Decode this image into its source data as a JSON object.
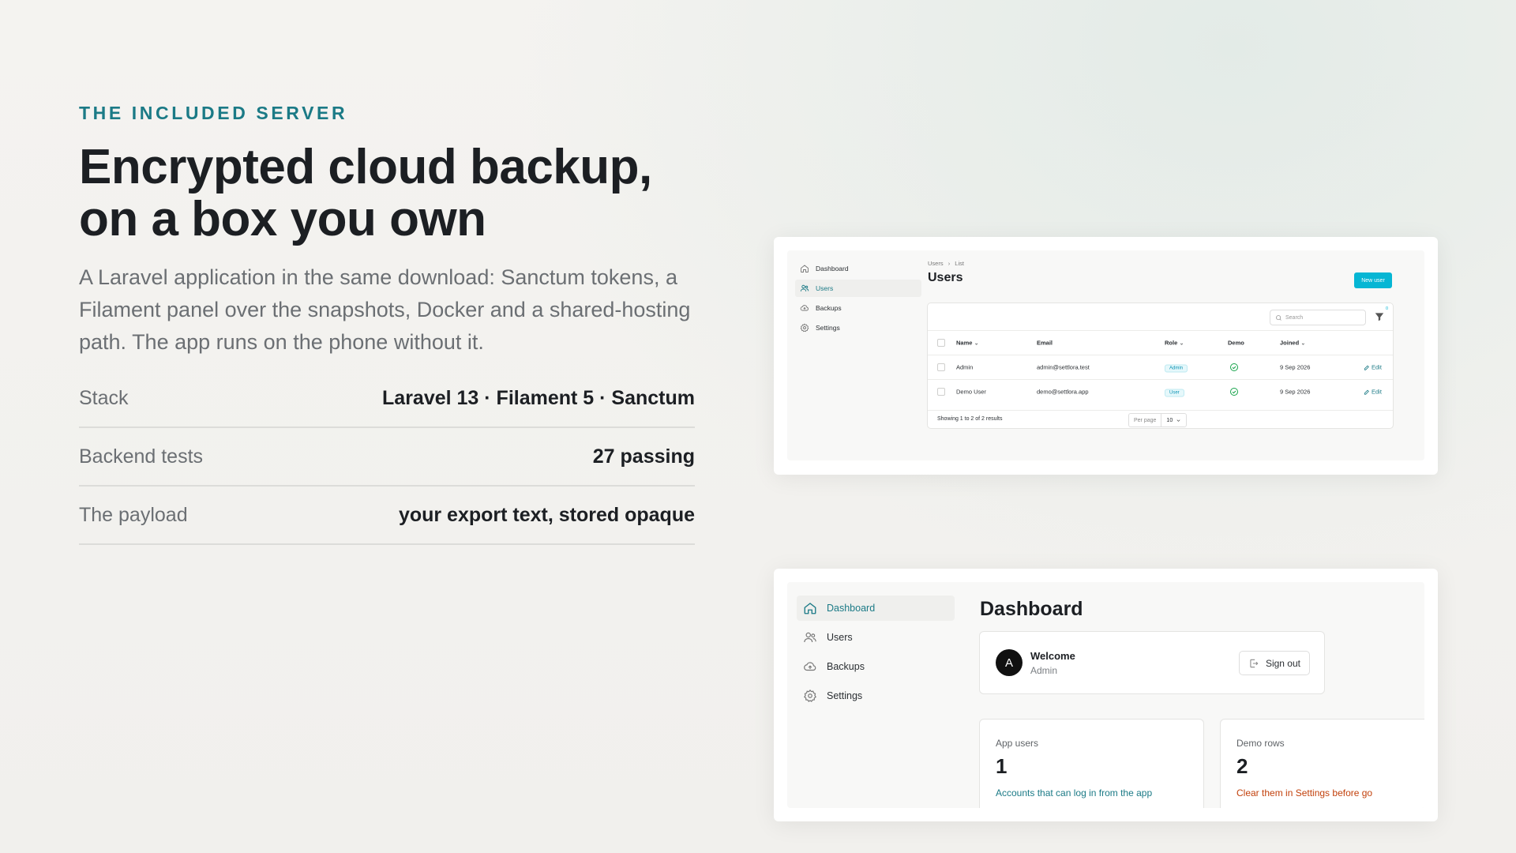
{
  "hero": {
    "eyebrow": "THE INCLUDED SERVER",
    "headline_line1": "Encrypted cloud backup,",
    "headline_line2": "on a box you own",
    "lede": "A Laravel application in the same download: Sanctum tokens, a Filament panel over the snapshots, Docker and a shared-hosting path. The app runs on the phone without it."
  },
  "facts": [
    {
      "label": "Stack",
      "value": "Laravel 13 · Filament 5 · Sanctum"
    },
    {
      "label": "Backend tests",
      "value": "27 passing"
    },
    {
      "label": "The payload",
      "value": "your export text, stored opaque"
    }
  ],
  "users_panel": {
    "nav": [
      {
        "label": "Dashboard",
        "icon": "home-icon"
      },
      {
        "label": "Users",
        "icon": "users-icon",
        "active": true
      },
      {
        "label": "Backups",
        "icon": "cloud-upload-icon"
      },
      {
        "label": "Settings",
        "icon": "gear-icon"
      }
    ],
    "breadcrumb": {
      "first": "Users",
      "separator": "›",
      "second": "List"
    },
    "title": "Users",
    "new_button": "New user",
    "search_placeholder": "Search",
    "filter_badge": "0",
    "columns": {
      "name": "Name",
      "email": "Email",
      "role": "Role",
      "demo": "Demo",
      "joined": "Joined"
    },
    "rows": [
      {
        "name": "Admin",
        "email": "admin@settlora.test",
        "role": "Admin",
        "joined": "9 Sep 2026",
        "edit": "Edit"
      },
      {
        "name": "Demo User",
        "email": "demo@settlora.app",
        "role": "User",
        "joined": "9 Sep 2026",
        "edit": "Edit"
      }
    ],
    "footer": {
      "showing": "Showing 1 to 2 of 2 results",
      "per_page_label": "Per page",
      "per_page_value": "10"
    }
  },
  "dashboard_panel": {
    "nav": [
      {
        "label": "Dashboard",
        "icon": "home-icon",
        "active": true
      },
      {
        "label": "Users",
        "icon": "users-icon"
      },
      {
        "label": "Backups",
        "icon": "cloud-upload-icon"
      },
      {
        "label": "Settings",
        "icon": "gear-icon"
      }
    ],
    "title": "Dashboard",
    "welcome": {
      "avatar": "A",
      "title": "Welcome",
      "subtitle": "Admin",
      "sign_out": "Sign out"
    },
    "stats": [
      {
        "label": "App users",
        "value": "1",
        "desc": "Accounts that can log in from the app",
        "color": "#1b7a86"
      },
      {
        "label": "Demo rows",
        "value": "2",
        "desc": "Clear them in Settings before go",
        "color": "#c2410c"
      }
    ]
  },
  "colors": {
    "accent": "#1b7a86",
    "primary_button": "#06b6d4",
    "warning": "#c2410c",
    "success": "#16a34a"
  }
}
